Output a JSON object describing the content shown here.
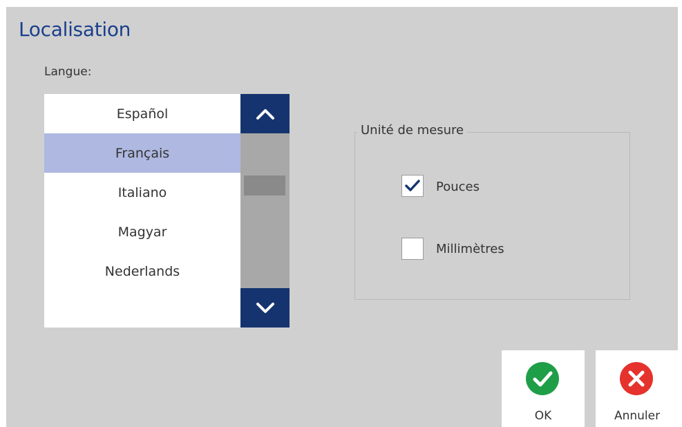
{
  "dialog": {
    "title": "Localisation",
    "language_label": "Langue:"
  },
  "language_list": {
    "items": [
      "Español",
      "Français",
      "Italiano",
      "Magyar",
      "Nederlands"
    ],
    "selected": "Français",
    "scroll_up_icon": "chevron-up-icon",
    "scroll_down_icon": "chevron-down-icon"
  },
  "units": {
    "legend": "Unité de mesure",
    "options": [
      {
        "label": "Pouces",
        "checked": true
      },
      {
        "label": "Millimètres",
        "checked": false
      }
    ]
  },
  "buttons": {
    "ok": {
      "label": "OK",
      "icon": "check-icon",
      "color": "#1f9e48"
    },
    "cancel": {
      "label": "Annuler",
      "icon": "close-icon",
      "color": "#e5322d"
    }
  },
  "colors": {
    "title": "#1a3f8c",
    "selection": "#aeb8e0",
    "scroll_button": "#15346f",
    "background": "#d0d0d0"
  }
}
